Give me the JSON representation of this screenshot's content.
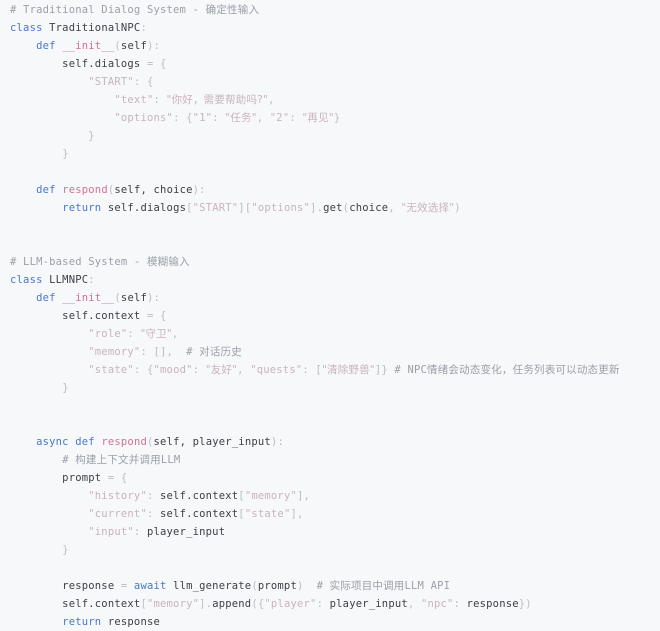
{
  "editor": {
    "language": "python",
    "background_color": "#f7f8fa",
    "font_size_px": 10.5,
    "line_height_px": 18,
    "palette": {
      "plain": "#3c4047",
      "keyword": "#4a76cf",
      "function": "#d4728f",
      "string": "#c9b3bd",
      "comment": "#9aa0a8",
      "punctuation": "#b9bec6"
    }
  },
  "code": {
    "title": "Traditional vs LLM NPC dialog system comparison",
    "lines": [
      {
        "n": 1,
        "text": "# Traditional Dialog System - 确定性输入",
        "tokens": [
          {
            "t": "comment",
            "v": "# Traditional Dialog System - "
          },
          {
            "t": "comment",
            "v": "确定性输入",
            "cjk": true
          }
        ]
      },
      {
        "n": 2,
        "text": "class TraditionalNPC:",
        "tokens": [
          {
            "t": "keyword",
            "v": "class"
          },
          {
            "t": "plain",
            "v": " "
          },
          {
            "t": "class",
            "v": "TraditionalNPC"
          },
          {
            "t": "punct",
            "v": ":"
          }
        ]
      },
      {
        "n": 3,
        "text": "    def __init__(self):",
        "tokens": [
          {
            "t": "plain",
            "v": "    "
          },
          {
            "t": "keyword",
            "v": "def"
          },
          {
            "t": "plain",
            "v": " "
          },
          {
            "t": "func",
            "v": "__init__"
          },
          {
            "t": "punct",
            "v": "("
          },
          {
            "t": "plain",
            "v": "self"
          },
          {
            "t": "punct",
            "v": "):"
          }
        ]
      },
      {
        "n": 4,
        "text": "        self.dialogs = {",
        "tokens": [
          {
            "t": "plain",
            "v": "        self.dialogs "
          },
          {
            "t": "punct",
            "v": "= {"
          }
        ]
      },
      {
        "n": 5,
        "text": "            \"START\": {",
        "tokens": [
          {
            "t": "plain",
            "v": "            "
          },
          {
            "t": "string",
            "v": "\"START\""
          },
          {
            "t": "punct",
            "v": ": {"
          }
        ]
      },
      {
        "n": 6,
        "text": "                \"text\": \"你好，需要帮助吗?\",",
        "tokens": [
          {
            "t": "plain",
            "v": "                "
          },
          {
            "t": "string",
            "v": "\"text\""
          },
          {
            "t": "punct",
            "v": ": "
          },
          {
            "t": "string",
            "v": "\"你好，需要帮助吗?\"",
            "cjk": true
          },
          {
            "t": "punct",
            "v": ","
          }
        ]
      },
      {
        "n": 7,
        "text": "                \"options\": {\"1\": \"任务\", \"2\": \"再见\"}",
        "tokens": [
          {
            "t": "plain",
            "v": "                "
          },
          {
            "t": "string",
            "v": "\"options\""
          },
          {
            "t": "punct",
            "v": ": {"
          },
          {
            "t": "string",
            "v": "\"1\""
          },
          {
            "t": "punct",
            "v": ": "
          },
          {
            "t": "string",
            "v": "\"任务\"",
            "cjk": true
          },
          {
            "t": "punct",
            "v": ", "
          },
          {
            "t": "string",
            "v": "\"2\""
          },
          {
            "t": "punct",
            "v": ": "
          },
          {
            "t": "string",
            "v": "\"再见\"",
            "cjk": true
          },
          {
            "t": "punct",
            "v": "}"
          }
        ]
      },
      {
        "n": 8,
        "text": "            }",
        "tokens": [
          {
            "t": "plain",
            "v": "            "
          },
          {
            "t": "punct",
            "v": "}"
          }
        ]
      },
      {
        "n": 9,
        "text": "        }",
        "tokens": [
          {
            "t": "plain",
            "v": "        "
          },
          {
            "t": "punct",
            "v": "}"
          }
        ]
      },
      {
        "n": 10,
        "text": "",
        "tokens": []
      },
      {
        "n": 11,
        "text": "    def respond(self, choice):",
        "tokens": [
          {
            "t": "plain",
            "v": "    "
          },
          {
            "t": "keyword",
            "v": "def"
          },
          {
            "t": "plain",
            "v": " "
          },
          {
            "t": "func",
            "v": "respond"
          },
          {
            "t": "punct",
            "v": "("
          },
          {
            "t": "plain",
            "v": "self, choice"
          },
          {
            "t": "punct",
            "v": "):"
          }
        ]
      },
      {
        "n": 12,
        "text": "        return self.dialogs[\"START\"][\"options\"].get(choice, \"无效选择\")",
        "tokens": [
          {
            "t": "plain",
            "v": "        "
          },
          {
            "t": "keyword",
            "v": "return"
          },
          {
            "t": "plain",
            "v": " self.dialogs"
          },
          {
            "t": "punct",
            "v": "["
          },
          {
            "t": "string",
            "v": "\"START\""
          },
          {
            "t": "punct",
            "v": "]["
          },
          {
            "t": "string",
            "v": "\"options\""
          },
          {
            "t": "punct",
            "v": "]."
          },
          {
            "t": "plain",
            "v": "get"
          },
          {
            "t": "punct",
            "v": "("
          },
          {
            "t": "plain",
            "v": "choice"
          },
          {
            "t": "punct",
            "v": ", "
          },
          {
            "t": "string",
            "v": "\"无效选择\"",
            "cjk": true
          },
          {
            "t": "punct",
            "v": ")"
          }
        ]
      },
      {
        "n": 13,
        "text": "",
        "tokens": []
      },
      {
        "n": 14,
        "text": "",
        "tokens": []
      },
      {
        "n": 15,
        "text": "# LLM-based System - 模糊输入",
        "tokens": [
          {
            "t": "comment",
            "v": "# LLM-based System - "
          },
          {
            "t": "comment",
            "v": "模糊输入",
            "cjk": true
          }
        ]
      },
      {
        "n": 16,
        "text": "class LLMNPC:",
        "tokens": [
          {
            "t": "keyword",
            "v": "class"
          },
          {
            "t": "plain",
            "v": " "
          },
          {
            "t": "class",
            "v": "LLMNPC"
          },
          {
            "t": "punct",
            "v": ":"
          }
        ]
      },
      {
        "n": 17,
        "text": "    def __init__(self):",
        "tokens": [
          {
            "t": "plain",
            "v": "    "
          },
          {
            "t": "keyword",
            "v": "def"
          },
          {
            "t": "plain",
            "v": " "
          },
          {
            "t": "func",
            "v": "__init__"
          },
          {
            "t": "punct",
            "v": "("
          },
          {
            "t": "plain",
            "v": "self"
          },
          {
            "t": "punct",
            "v": "):"
          }
        ]
      },
      {
        "n": 18,
        "text": "        self.context = {",
        "tokens": [
          {
            "t": "plain",
            "v": "        self.context "
          },
          {
            "t": "punct",
            "v": "= {"
          }
        ]
      },
      {
        "n": 19,
        "text": "            \"role\": \"守卫\",",
        "tokens": [
          {
            "t": "plain",
            "v": "            "
          },
          {
            "t": "string",
            "v": "\"role\""
          },
          {
            "t": "punct",
            "v": ": "
          },
          {
            "t": "string",
            "v": "\"守卫\"",
            "cjk": true
          },
          {
            "t": "punct",
            "v": ","
          }
        ]
      },
      {
        "n": 20,
        "text": "            \"memory\": [],  # 对话历史",
        "tokens": [
          {
            "t": "plain",
            "v": "            "
          },
          {
            "t": "string",
            "v": "\"memory\""
          },
          {
            "t": "punct",
            "v": ": [],  "
          },
          {
            "t": "comment",
            "v": "# "
          },
          {
            "t": "comment",
            "v": "对话历史",
            "cjk": true
          }
        ]
      },
      {
        "n": 21,
        "text": "            \"state\": {\"mood\": \"友好\", \"quests\": [\"清除野兽\"]} # NPC情绪会动态变化，任务列表可以动态更新",
        "tokens": [
          {
            "t": "plain",
            "v": "            "
          },
          {
            "t": "string",
            "v": "\"state\""
          },
          {
            "t": "punct",
            "v": ": {"
          },
          {
            "t": "string",
            "v": "\"mood\""
          },
          {
            "t": "punct",
            "v": ": "
          },
          {
            "t": "string",
            "v": "\"友好\"",
            "cjk": true
          },
          {
            "t": "punct",
            "v": ", "
          },
          {
            "t": "string",
            "v": "\"quests\""
          },
          {
            "t": "punct",
            "v": ": ["
          },
          {
            "t": "string",
            "v": "\"清除野兽\"",
            "cjk": true
          },
          {
            "t": "punct",
            "v": "]} "
          },
          {
            "t": "comment",
            "v": "# NPC"
          },
          {
            "t": "comment",
            "v": "情绪会动态变化，任务列表可以动态更新",
            "cjk": true
          }
        ]
      },
      {
        "n": 22,
        "text": "        }",
        "tokens": [
          {
            "t": "plain",
            "v": "        "
          },
          {
            "t": "punct",
            "v": "}"
          }
        ]
      },
      {
        "n": 23,
        "text": "",
        "tokens": []
      },
      {
        "n": 24,
        "text": "",
        "tokens": []
      },
      {
        "n": 25,
        "text": "    async def respond(self, player_input):",
        "tokens": [
          {
            "t": "plain",
            "v": "    "
          },
          {
            "t": "keyword",
            "v": "async"
          },
          {
            "t": "plain",
            "v": " "
          },
          {
            "t": "keyword",
            "v": "def"
          },
          {
            "t": "plain",
            "v": " "
          },
          {
            "t": "func",
            "v": "respond"
          },
          {
            "t": "punct",
            "v": "("
          },
          {
            "t": "plain",
            "v": "self, player_input"
          },
          {
            "t": "punct",
            "v": "):"
          }
        ]
      },
      {
        "n": 26,
        "text": "        # 构建上下文并调用LLM",
        "tokens": [
          {
            "t": "plain",
            "v": "        "
          },
          {
            "t": "comment",
            "v": "# "
          },
          {
            "t": "comment",
            "v": "构建上下文并调用",
            "cjk": true
          },
          {
            "t": "comment",
            "v": "LLM"
          }
        ]
      },
      {
        "n": 27,
        "text": "        prompt = {",
        "tokens": [
          {
            "t": "plain",
            "v": "        prompt "
          },
          {
            "t": "punct",
            "v": "= {"
          }
        ]
      },
      {
        "n": 28,
        "text": "            \"history\": self.context[\"memory\"],",
        "tokens": [
          {
            "t": "plain",
            "v": "            "
          },
          {
            "t": "string",
            "v": "\"history\""
          },
          {
            "t": "punct",
            "v": ": "
          },
          {
            "t": "plain",
            "v": "self.context"
          },
          {
            "t": "punct",
            "v": "["
          },
          {
            "t": "string",
            "v": "\"memory\""
          },
          {
            "t": "punct",
            "v": "],"
          }
        ]
      },
      {
        "n": 29,
        "text": "            \"current\": self.context[\"state\"],",
        "tokens": [
          {
            "t": "plain",
            "v": "            "
          },
          {
            "t": "string",
            "v": "\"current\""
          },
          {
            "t": "punct",
            "v": ": "
          },
          {
            "t": "plain",
            "v": "self.context"
          },
          {
            "t": "punct",
            "v": "["
          },
          {
            "t": "string",
            "v": "\"state\""
          },
          {
            "t": "punct",
            "v": "],"
          }
        ]
      },
      {
        "n": 30,
        "text": "            \"input\": player_input",
        "tokens": [
          {
            "t": "plain",
            "v": "            "
          },
          {
            "t": "string",
            "v": "\"input\""
          },
          {
            "t": "punct",
            "v": ": "
          },
          {
            "t": "plain",
            "v": "player_input"
          }
        ]
      },
      {
        "n": 31,
        "text": "        }",
        "tokens": [
          {
            "t": "plain",
            "v": "        "
          },
          {
            "t": "punct",
            "v": "}"
          }
        ]
      },
      {
        "n": 32,
        "text": "",
        "tokens": []
      },
      {
        "n": 33,
        "text": "        response = await llm_generate(prompt)  # 实际项目中调用LLM API",
        "tokens": [
          {
            "t": "plain",
            "v": "        response "
          },
          {
            "t": "punct",
            "v": "= "
          },
          {
            "t": "keyword",
            "v": "await"
          },
          {
            "t": "plain",
            "v": " llm_generate"
          },
          {
            "t": "punct",
            "v": "("
          },
          {
            "t": "plain",
            "v": "prompt"
          },
          {
            "t": "punct",
            "v": ")  "
          },
          {
            "t": "comment",
            "v": "# "
          },
          {
            "t": "comment",
            "v": "实际项目中调用",
            "cjk": true
          },
          {
            "t": "comment",
            "v": "LLM API"
          }
        ]
      },
      {
        "n": 34,
        "text": "        self.context[\"memory\"].append({\"player\": player_input, \"npc\": response})",
        "tokens": [
          {
            "t": "plain",
            "v": "        self.context"
          },
          {
            "t": "punct",
            "v": "["
          },
          {
            "t": "string",
            "v": "\"memory\""
          },
          {
            "t": "punct",
            "v": "]."
          },
          {
            "t": "plain",
            "v": "append"
          },
          {
            "t": "punct",
            "v": "({"
          },
          {
            "t": "string",
            "v": "\"player\""
          },
          {
            "t": "punct",
            "v": ": "
          },
          {
            "t": "plain",
            "v": "player_input"
          },
          {
            "t": "punct",
            "v": ", "
          },
          {
            "t": "string",
            "v": "\"npc\""
          },
          {
            "t": "punct",
            "v": ": "
          },
          {
            "t": "plain",
            "v": "response"
          },
          {
            "t": "punct",
            "v": "})"
          }
        ]
      },
      {
        "n": 35,
        "text": "        return response",
        "tokens": [
          {
            "t": "plain",
            "v": "        "
          },
          {
            "t": "keyword",
            "v": "return"
          },
          {
            "t": "plain",
            "v": " response"
          }
        ]
      }
    ]
  }
}
